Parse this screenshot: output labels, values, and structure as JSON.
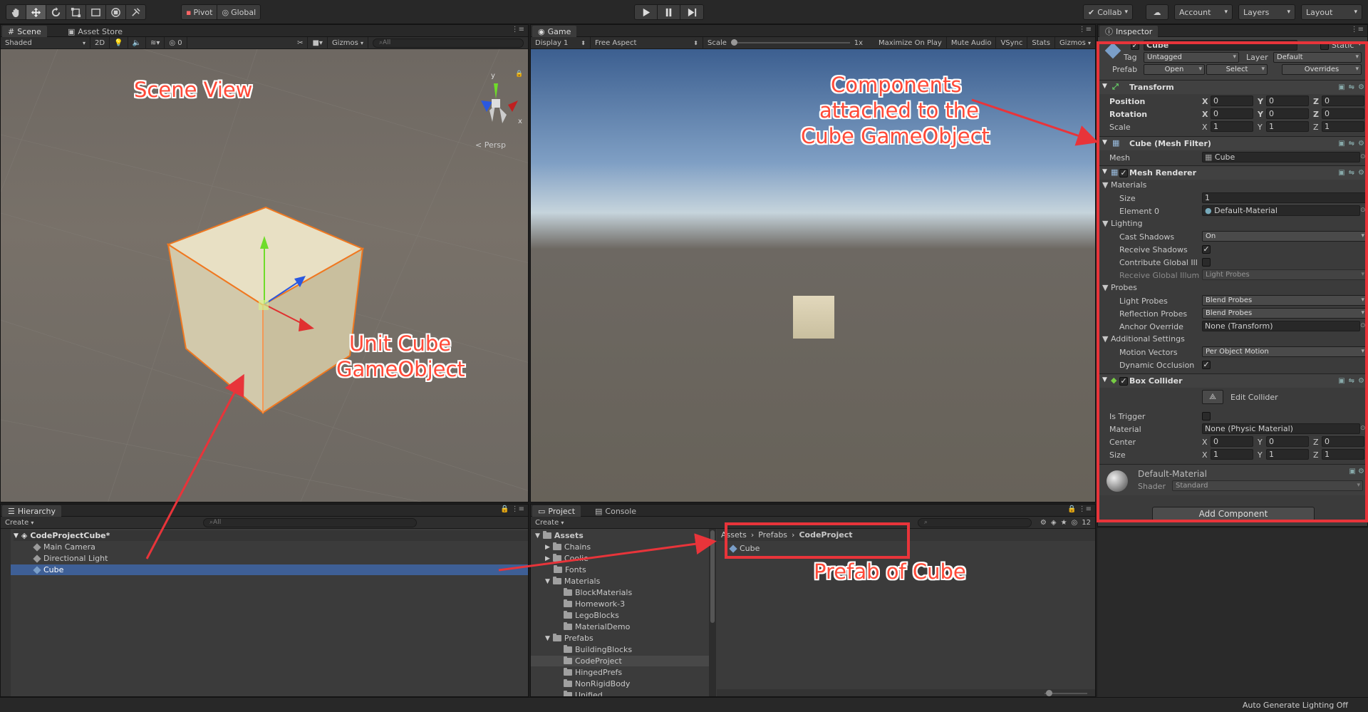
{
  "toolbar": {
    "tools": [
      "hand-icon",
      "move-icon",
      "rotate-icon",
      "scale-icon",
      "rect-icon",
      "transform-icon",
      "custom-icon"
    ],
    "pivot_label": "Pivot",
    "global_label": "Global",
    "collab_label": "Collab",
    "account_label": "Account",
    "layers_label": "Layers",
    "layout_label": "Layout"
  },
  "scene": {
    "tab_scene": "Scene",
    "tab_asset_store": "Asset Store",
    "shading": "Shaded",
    "mode_2d": "2D",
    "hidden_count": "0",
    "gizmos": "Gizmos",
    "search": "All",
    "persp": "< Persp",
    "axis_x": "x",
    "axis_y": "y"
  },
  "game": {
    "tab": "Game",
    "display": "Display 1",
    "aspect": "Free Aspect",
    "scale_label": "Scale",
    "scale_value": "1x",
    "maximize": "Maximize On Play",
    "mute": "Mute Audio",
    "vsync": "VSync",
    "stats": "Stats",
    "gizmos": "Gizmos"
  },
  "inspector": {
    "tab": "Inspector",
    "object_name": "Cube",
    "static_label": "Static",
    "tag_label": "Tag",
    "tag_value": "Untagged",
    "layer_label": "Layer",
    "layer_value": "Default",
    "prefab_label": "Prefab",
    "open_label": "Open",
    "select_label": "Select",
    "overrides_label": "Overrides",
    "transform": {
      "title": "Transform",
      "position_label": "Position",
      "rotation_label": "Rotation",
      "scale_label": "Scale",
      "position": [
        "0",
        "0",
        "0"
      ],
      "rotation": [
        "0",
        "0",
        "0"
      ],
      "scale": [
        "1",
        "1",
        "1"
      ]
    },
    "mesh_filter": {
      "title": "Cube (Mesh Filter)",
      "mesh_label": "Mesh",
      "mesh_value": "Cube"
    },
    "mesh_renderer": {
      "title": "Mesh Renderer",
      "materials_label": "Materials",
      "size_label": "Size",
      "size_value": "1",
      "element0_label": "Element 0",
      "element0_value": "Default-Material",
      "lighting_label": "Lighting",
      "cast_shadows_label": "Cast Shadows",
      "cast_shadows_value": "On",
      "receive_shadows_label": "Receive Shadows",
      "contribute_gi_label": "Contribute Global Ill",
      "receive_gi_label": "Receive Global Illum",
      "receive_gi_value": "Light Probes",
      "probes_label": "Probes",
      "light_probes_label": "Light Probes",
      "light_probes_value": "Blend Probes",
      "reflection_probes_label": "Reflection Probes",
      "reflection_probes_value": "Blend Probes",
      "anchor_label": "Anchor Override",
      "anchor_value": "None (Transform)",
      "additional_label": "Additional Settings",
      "motion_vectors_label": "Motion Vectors",
      "motion_vectors_value": "Per Object Motion",
      "dynamic_occlusion_label": "Dynamic Occlusion"
    },
    "box_collider": {
      "title": "Box Collider",
      "edit_label": "Edit Collider",
      "is_trigger_label": "Is Trigger",
      "material_label": "Material",
      "material_value": "None (Physic Material)",
      "center_label": "Center",
      "center": [
        "0",
        "0",
        "0"
      ],
      "size_label": "Size",
      "size": [
        "1",
        "1",
        "1"
      ]
    },
    "material": {
      "name": "Default-Material",
      "shader_label": "Shader",
      "shader_value": "Standard"
    },
    "add_component": "Add Component"
  },
  "hierarchy": {
    "tab": "Hierarchy",
    "create": "Create",
    "search": "All",
    "scene_name": "CodeProjectCube*",
    "items": [
      "Main Camera",
      "Directional Light",
      "Cube"
    ]
  },
  "project": {
    "tab_project": "Project",
    "tab_console": "Console",
    "create": "Create",
    "hidden_count": "12",
    "assets_label": "Assets",
    "tree": [
      "Chains",
      "Coolie",
      "Fonts",
      "Materials",
      "BlockMaterials",
      "Homework-3",
      "LegoBlocks",
      "MaterialDemo",
      "Prefabs",
      "BuildingBlocks",
      "CodeProject",
      "HingedPrefs",
      "NonRigidBody",
      "Unified"
    ],
    "breadcrumb": [
      "Assets",
      "Prefabs",
      "CodeProject"
    ],
    "content_item": "Cube"
  },
  "status_bar": {
    "text": "Auto Generate Lighting Off"
  },
  "annotations": {
    "scene_view": "Scene View",
    "unit_cube_1": "Unit Cube",
    "unit_cube_2": "GameObject",
    "components_1": "Components",
    "components_2": "attached to the",
    "components_3": "Cube GameObject",
    "prefab": "Prefab of Cube"
  },
  "colors": {
    "annotation_red": "#e8343a",
    "selection_blue": "#3e5f96",
    "cube_fill": "#d9cfae",
    "cube_outline": "#f07820"
  }
}
